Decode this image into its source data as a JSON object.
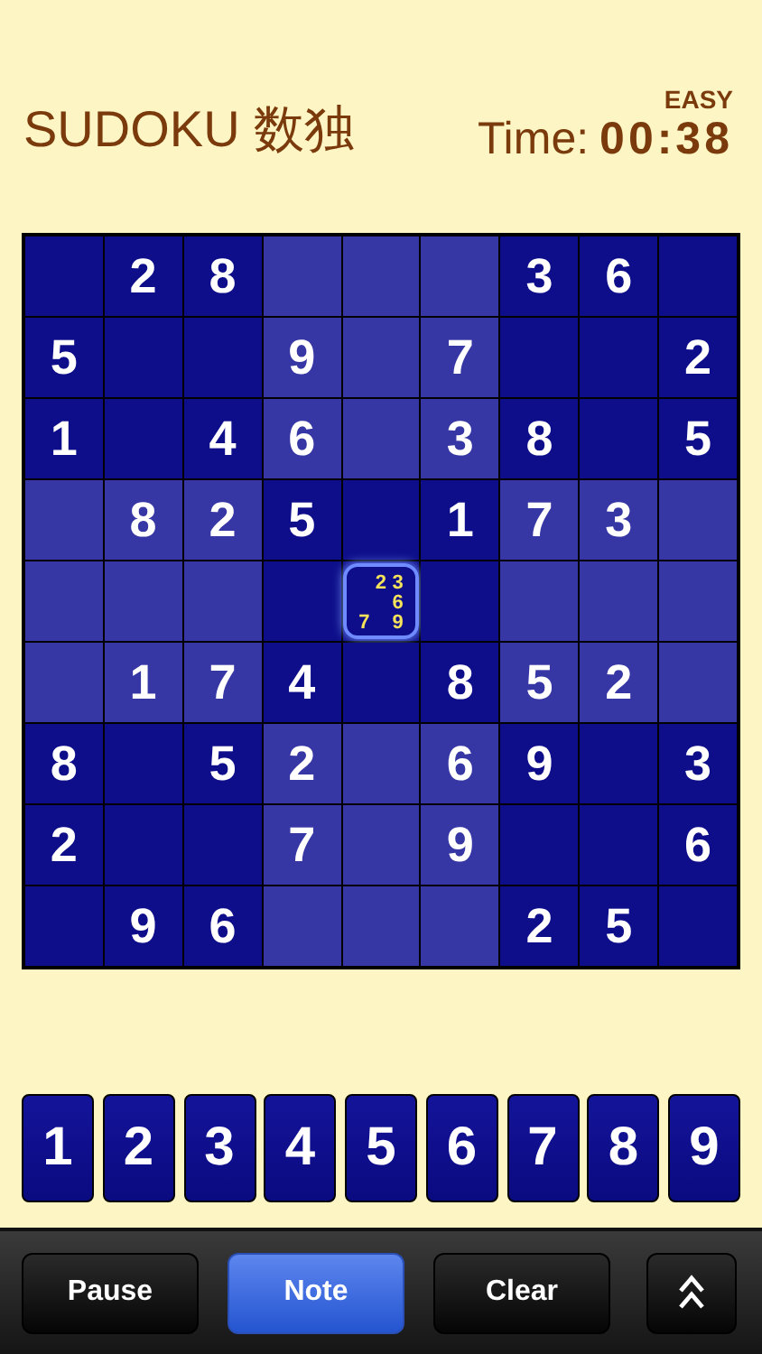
{
  "header": {
    "title": "SUDOKU 数独",
    "difficulty": "EASY",
    "time_label": "Time:",
    "time_value": "00:38"
  },
  "grid": {
    "rows": [
      [
        null,
        "2",
        "8",
        null,
        null,
        null,
        "3",
        "6",
        null
      ],
      [
        "5",
        null,
        null,
        "9",
        null,
        "7",
        null,
        null,
        "2"
      ],
      [
        "1",
        null,
        "4",
        "6",
        null,
        "3",
        "8",
        null,
        "5"
      ],
      [
        null,
        "8",
        "2",
        "5",
        null,
        "1",
        "7",
        "3",
        null
      ],
      [
        null,
        null,
        null,
        null,
        {
          "selected": true,
          "notes": [
            {
              "kind": "blank"
            },
            {
              "kind": "digit",
              "digit": "2"
            },
            {
              "kind": "digit",
              "digit": "3"
            },
            {
              "kind": "blank"
            },
            {
              "kind": "blank"
            },
            {
              "kind": "digit",
              "digit": "6"
            },
            {
              "kind": "digit",
              "digit": "7"
            },
            {
              "kind": "blank"
            },
            {
              "kind": "digit",
              "digit": "9"
            }
          ]
        },
        null,
        null,
        null,
        null
      ],
      [
        null,
        "1",
        "7",
        "4",
        null,
        "8",
        "5",
        "2",
        null
      ],
      [
        "8",
        null,
        "5",
        "2",
        null,
        "6",
        "9",
        null,
        "3"
      ],
      [
        "2",
        null,
        null,
        "7",
        null,
        "9",
        null,
        null,
        "6"
      ],
      [
        null,
        "9",
        "6",
        null,
        null,
        null,
        "2",
        "5",
        null
      ]
    ]
  },
  "keypad": [
    "1",
    "2",
    "3",
    "4",
    "5",
    "6",
    "7",
    "8",
    "9"
  ],
  "toolbar": [
    {
      "kind": "text",
      "label": "Pause",
      "selected": false
    },
    {
      "kind": "text",
      "label": "Note",
      "selected": true
    },
    {
      "kind": "text",
      "label": "Clear",
      "selected": false
    },
    {
      "kind": "icon",
      "selected": false
    }
  ]
}
